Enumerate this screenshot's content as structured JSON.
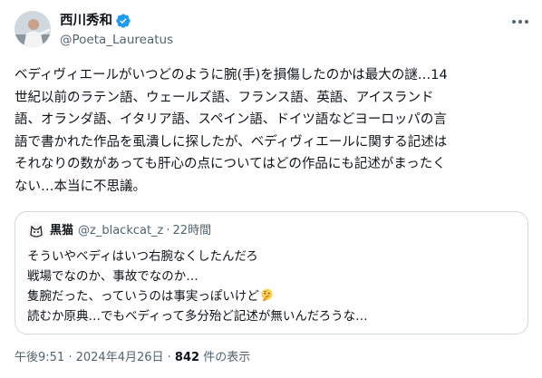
{
  "author": {
    "display_name": "西川秀和",
    "handle": "@Poeta_Laureatus",
    "verified_icon": "verified-badge-icon"
  },
  "tweet": {
    "text": "ベディヴィエールがいつどのように腕(手)を損傷したのかは最大の謎…14\n世紀以前のラテン語、ウェールズ語、フランス語、英語、アイスランド\n語、オランダ語、イタリア語、スペイン語、ドイツ語などヨーロッパの言\n語で書かれた作品を虱潰しに探したが、ベディヴィエールに関する記述は\nそれなりの数があっても肝心の点についてはどの作品にも記述がまったく\nない…本当に不思議。"
  },
  "quoted": {
    "name": "黒猫",
    "handle": "@z_blackcat_z",
    "separator": "·",
    "time": "22時間",
    "text": "そういやベディはいつ右腕なくしたんだろ\n戦場でなのか、事故でなのか…\n隻腕だった、っていうのは事実っぽいけど",
    "text_end": "\n読むか原典…でもベディって多分殆ど記述が無いんだろうな…",
    "emoji": "thinking-face-icon"
  },
  "footer": {
    "time": "午後9:51",
    "separator": " · ",
    "date": "2024年4月26日",
    "views_count": "842",
    "views_label": " 件の表示"
  },
  "colors": {
    "text": "#0f1419",
    "secondary": "#536471",
    "border": "#cfd9de",
    "verified": "#1d9bf0"
  }
}
